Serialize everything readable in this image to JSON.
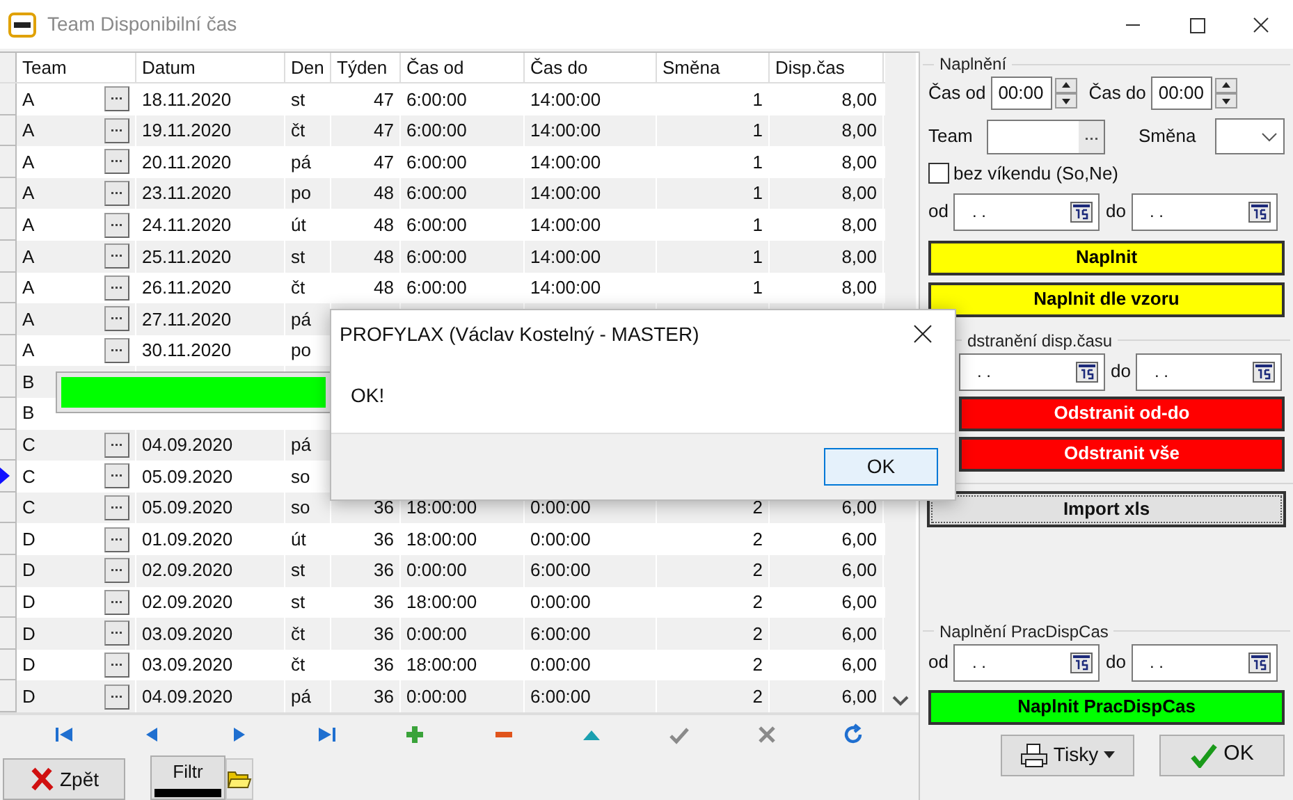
{
  "window": {
    "title": "Team Disponibilní čas"
  },
  "table": {
    "columns": [
      "Team",
      "Datum",
      "Den",
      "Týden",
      "Čas od",
      "Čas do",
      "Směna",
      "Disp.čas"
    ],
    "rows": [
      {
        "team": "A",
        "datum": "18.11.2020",
        "den": "st",
        "tyden": "47",
        "cas_od": "6:00:00",
        "cas_do": "14:00:00",
        "smena": "1",
        "disp": "8,00",
        "selected": false
      },
      {
        "team": "A",
        "datum": "19.11.2020",
        "den": "čt",
        "tyden": "47",
        "cas_od": "6:00:00",
        "cas_do": "14:00:00",
        "smena": "1",
        "disp": "8,00",
        "selected": false
      },
      {
        "team": "A",
        "datum": "20.11.2020",
        "den": "pá",
        "tyden": "47",
        "cas_od": "6:00:00",
        "cas_do": "14:00:00",
        "smena": "1",
        "disp": "8,00",
        "selected": false
      },
      {
        "team": "A",
        "datum": "23.11.2020",
        "den": "po",
        "tyden": "48",
        "cas_od": "6:00:00",
        "cas_do": "14:00:00",
        "smena": "1",
        "disp": "8,00",
        "selected": false
      },
      {
        "team": "A",
        "datum": "24.11.2020",
        "den": "út",
        "tyden": "48",
        "cas_od": "6:00:00",
        "cas_do": "14:00:00",
        "smena": "1",
        "disp": "8,00",
        "selected": false
      },
      {
        "team": "A",
        "datum": "25.11.2020",
        "den": "st",
        "tyden": "48",
        "cas_od": "6:00:00",
        "cas_do": "14:00:00",
        "smena": "1",
        "disp": "8,00",
        "selected": false
      },
      {
        "team": "A",
        "datum": "26.11.2020",
        "den": "čt",
        "tyden": "48",
        "cas_od": "6:00:00",
        "cas_do": "14:00:00",
        "smena": "1",
        "disp": "8,00",
        "selected": false
      },
      {
        "team": "A",
        "datum": "27.11.2020",
        "den": "pá",
        "selected": false
      },
      {
        "team": "A",
        "datum": "30.11.2020",
        "den": "po",
        "selected": false
      },
      {
        "team": "B",
        "selected": false
      },
      {
        "team": "B",
        "selected": false
      },
      {
        "team": "C",
        "datum": "04.09.2020",
        "den": "pá",
        "selected": false
      },
      {
        "team": "C",
        "datum": "05.09.2020",
        "den": "so",
        "selected": true
      },
      {
        "team": "C",
        "datum": "05.09.2020",
        "den": "so",
        "tyden": "36",
        "cas_od": "18:00:00",
        "cas_do": "0:00:00",
        "smena": "2",
        "disp": "6,00",
        "selected": false
      },
      {
        "team": "D",
        "datum": "01.09.2020",
        "den": "út",
        "tyden": "36",
        "cas_od": "18:00:00",
        "cas_do": "0:00:00",
        "smena": "2",
        "disp": "6,00",
        "selected": false
      },
      {
        "team": "D",
        "datum": "02.09.2020",
        "den": "st",
        "tyden": "36",
        "cas_od": "0:00:00",
        "cas_do": "6:00:00",
        "smena": "2",
        "disp": "6,00",
        "selected": false
      },
      {
        "team": "D",
        "datum": "02.09.2020",
        "den": "st",
        "tyden": "36",
        "cas_od": "18:00:00",
        "cas_do": "0:00:00",
        "smena": "2",
        "disp": "6,00",
        "selected": false
      },
      {
        "team": "D",
        "datum": "03.09.2020",
        "den": "čt",
        "tyden": "36",
        "cas_od": "0:00:00",
        "cas_do": "6:00:00",
        "smena": "2",
        "disp": "6,00",
        "selected": false
      },
      {
        "team": "D",
        "datum": "03.09.2020",
        "den": "čt",
        "tyden": "36",
        "cas_od": "18:00:00",
        "cas_do": "0:00:00",
        "smena": "2",
        "disp": "6,00",
        "selected": false
      },
      {
        "team": "D",
        "datum": "04.09.2020",
        "den": "pá",
        "tyden": "36",
        "cas_od": "0:00:00",
        "cas_do": "6:00:00",
        "smena": "2",
        "disp": "6,00",
        "selected": false
      }
    ]
  },
  "progress": {
    "level": 1
  },
  "navigator": [
    {
      "kind": "first",
      "disabled": false
    },
    {
      "kind": "prev",
      "disabled": false
    },
    {
      "kind": "next",
      "disabled": false
    },
    {
      "kind": "last",
      "disabled": false
    },
    {
      "kind": "add",
      "disabled": false
    },
    {
      "kind": "delete",
      "disabled": false
    },
    {
      "kind": "edit",
      "disabled": false
    },
    {
      "kind": "post",
      "disabled": true
    },
    {
      "kind": "cancel",
      "disabled": true
    },
    {
      "kind": "refresh",
      "disabled": false
    }
  ],
  "fill_panel": {
    "title": "Naplnění",
    "time_from_label": "Čas od",
    "time_from": "00:00",
    "time_to_label": "Čas do",
    "time_to": "00:00",
    "team_label": "Team",
    "shift_label": "Směna",
    "weekend": {
      "label": "bez víkendu (So,Ne)",
      "checked": false
    },
    "from_label": "od",
    "from_value": ". .",
    "to_label": "do",
    "to_value": ". .",
    "buttons": [
      {
        "label": "Naplnit",
        "color": "#ffff00"
      },
      {
        "label": "Naplnit dle vzoru",
        "color": "#ffff00"
      }
    ]
  },
  "remove_panel": {
    "title": "dstranění disp.času",
    "from_value": ". .",
    "to_label": "do",
    "to_value": ". .",
    "buttons": [
      {
        "label": "Odstranit od-do",
        "color": "#ff0000"
      },
      {
        "label": "Odstranit vše",
        "color": "#ff0000"
      }
    ]
  },
  "import_button": "Import xls",
  "pracdisp_panel": {
    "title": "Naplnění PracDispCas",
    "from_label": "od",
    "from_value": ". .",
    "to_label": "do",
    "to_value": ". .",
    "button": {
      "label": "Naplnit PracDispCas",
      "color": "#00ff00"
    }
  },
  "footer": {
    "back": "Zpět",
    "filter": "Filtr",
    "print": "Tisky",
    "ok": "OK"
  },
  "dialog": {
    "title": "PROFYLAX (Václav Kostelný - MASTER)",
    "message": "OK!",
    "button": "OK"
  }
}
